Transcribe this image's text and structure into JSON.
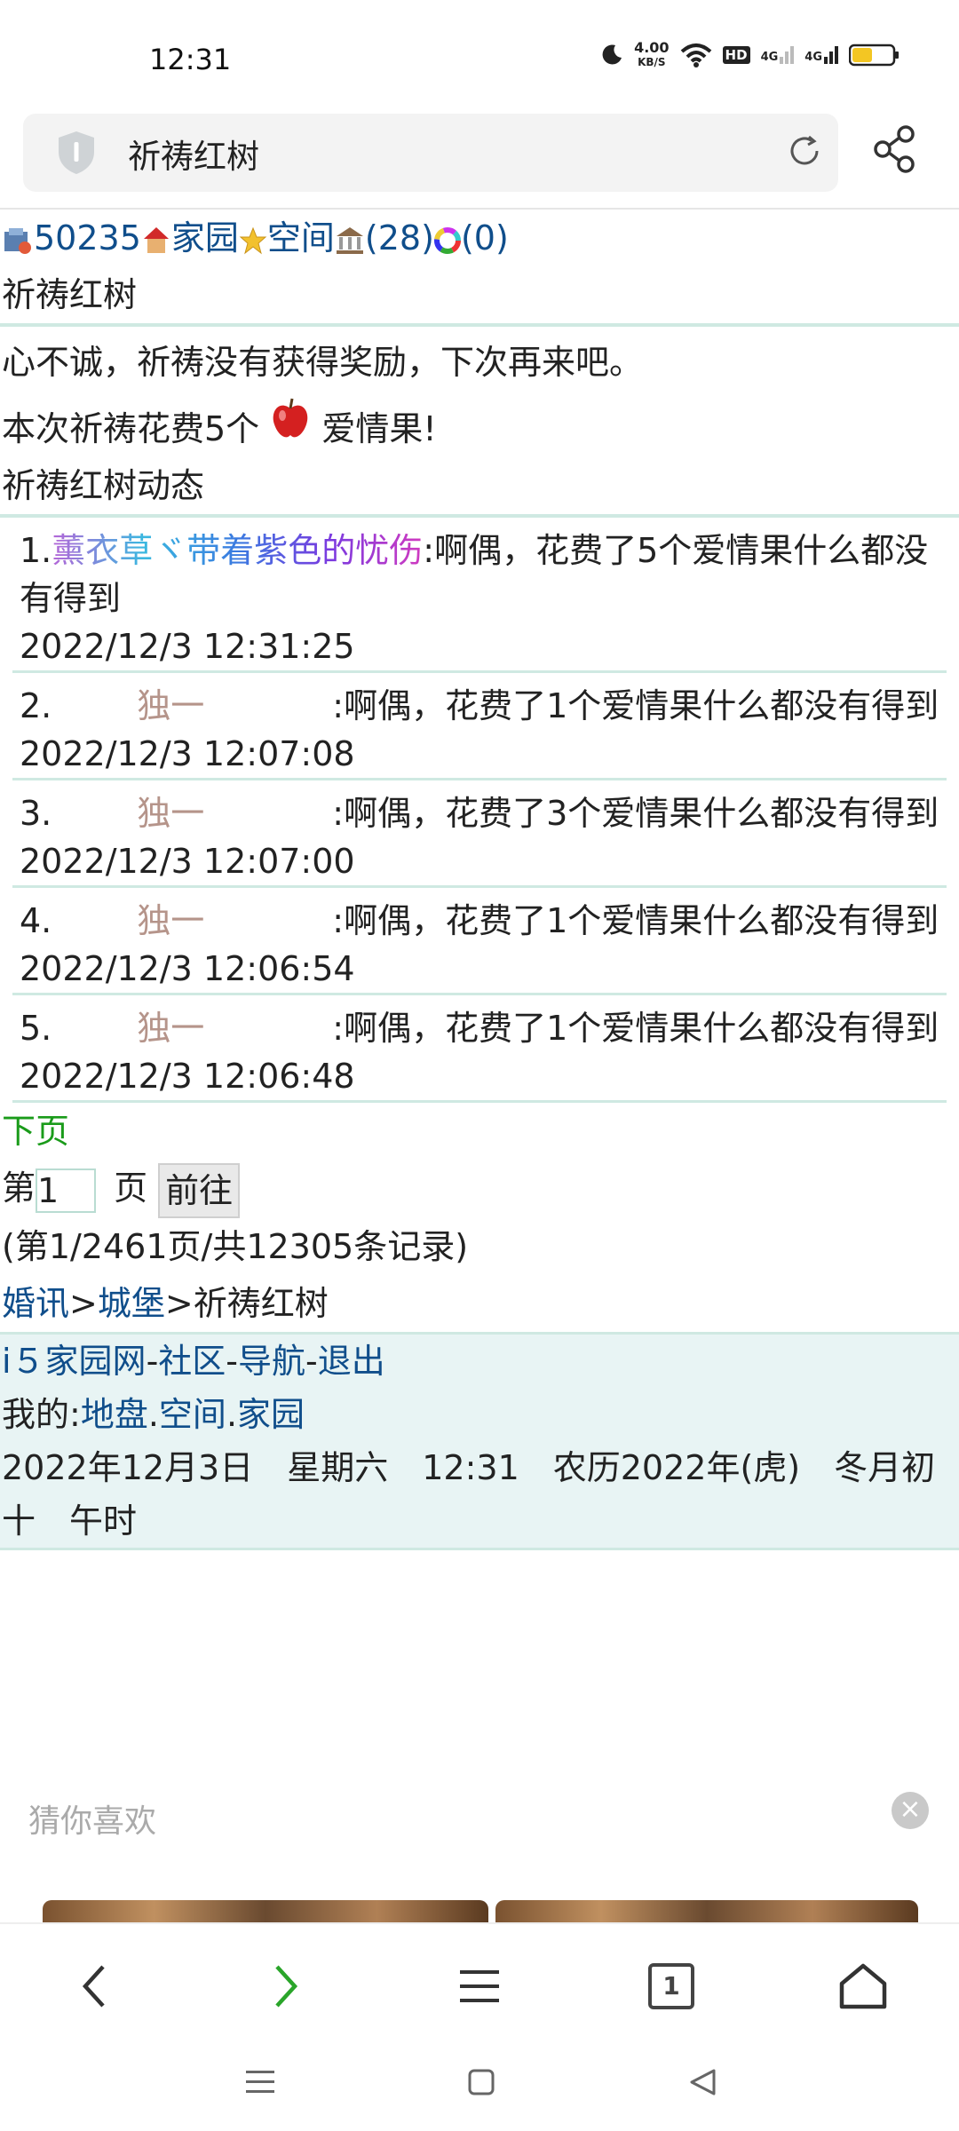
{
  "status_bar": {
    "time": "12:31",
    "speed_value": "4.00",
    "speed_unit": "KB/S",
    "hd_label": "HD",
    "sim1_label": "4G",
    "sim2_label": "4G"
  },
  "address_bar": {
    "title": "祈祷红树"
  },
  "top_links": {
    "id_number": "50235",
    "home": "家园",
    "space": "空间",
    "count1": "(28)",
    "count2": "(0)"
  },
  "page_heading": "祈祷红树",
  "result_message": "心不诚，祈祷没有获得奖励，下次再来吧。",
  "cost_message": {
    "prefix": "本次祈祷花费5个",
    "suffix": "爱情果!"
  },
  "activity_heading": "祈祷红树动态",
  "records": [
    {
      "index": "1.",
      "user": "薰衣草ヾ带着紫色的忧伤",
      "action": ":啊偶，花费了5个爱情果什么都没有得到",
      "time": "2022/12/3  12:31:25"
    },
    {
      "index": "2.",
      "user": "独一",
      "action": ":啊偶，花费了1个爱情果什么都没有得到",
      "time": "2022/12/3  12:07:08"
    },
    {
      "index": "3.",
      "user": "独一",
      "action": ":啊偶，花费了3个爱情果什么都没有得到",
      "time": "2022/12/3  12:07:00"
    },
    {
      "index": "4.",
      "user": "独一",
      "action": ":啊偶，花费了1个爱情果什么都没有得到",
      "time": "2022/12/3  12:06:54"
    },
    {
      "index": "5.",
      "user": "独一",
      "action": ":啊偶，花费了1个爱情果什么都没有得到",
      "time": "2022/12/3  12:06:48"
    }
  ],
  "pagination": {
    "next_label": "下页",
    "page_prefix": "第",
    "page_value": "1",
    "page_suffix": "页",
    "go_label": "前往",
    "summary": "(第1/2461页/共12305条记录)"
  },
  "breadcrumb": {
    "item1": "婚讯",
    "sep1": ">",
    "item2": "城堡",
    "sep2": ">",
    "current": "祈祷红树"
  },
  "footer": {
    "site": "i５家园网",
    "community": "社区",
    "nav": "导航",
    "logout": "退出",
    "dash": "-",
    "my_label": "我的:",
    "my_land": "地盘",
    "my_space": "空间",
    "my_home": "家园",
    "dot": ".",
    "date_line": "2022年12月3日　星期六　12:31　农历2022年(虎)　冬月初十　午时"
  },
  "guess": {
    "title": "猜你喜欢",
    "close": "×"
  },
  "browser_nav": {
    "tab_count": "1"
  },
  "colors": {
    "link": "#104e8b",
    "next_link": "#1a9b1a",
    "divider": "#cfe9e2",
    "footer_bg": "#e8f4f4",
    "username_brown": "#b5948a"
  }
}
